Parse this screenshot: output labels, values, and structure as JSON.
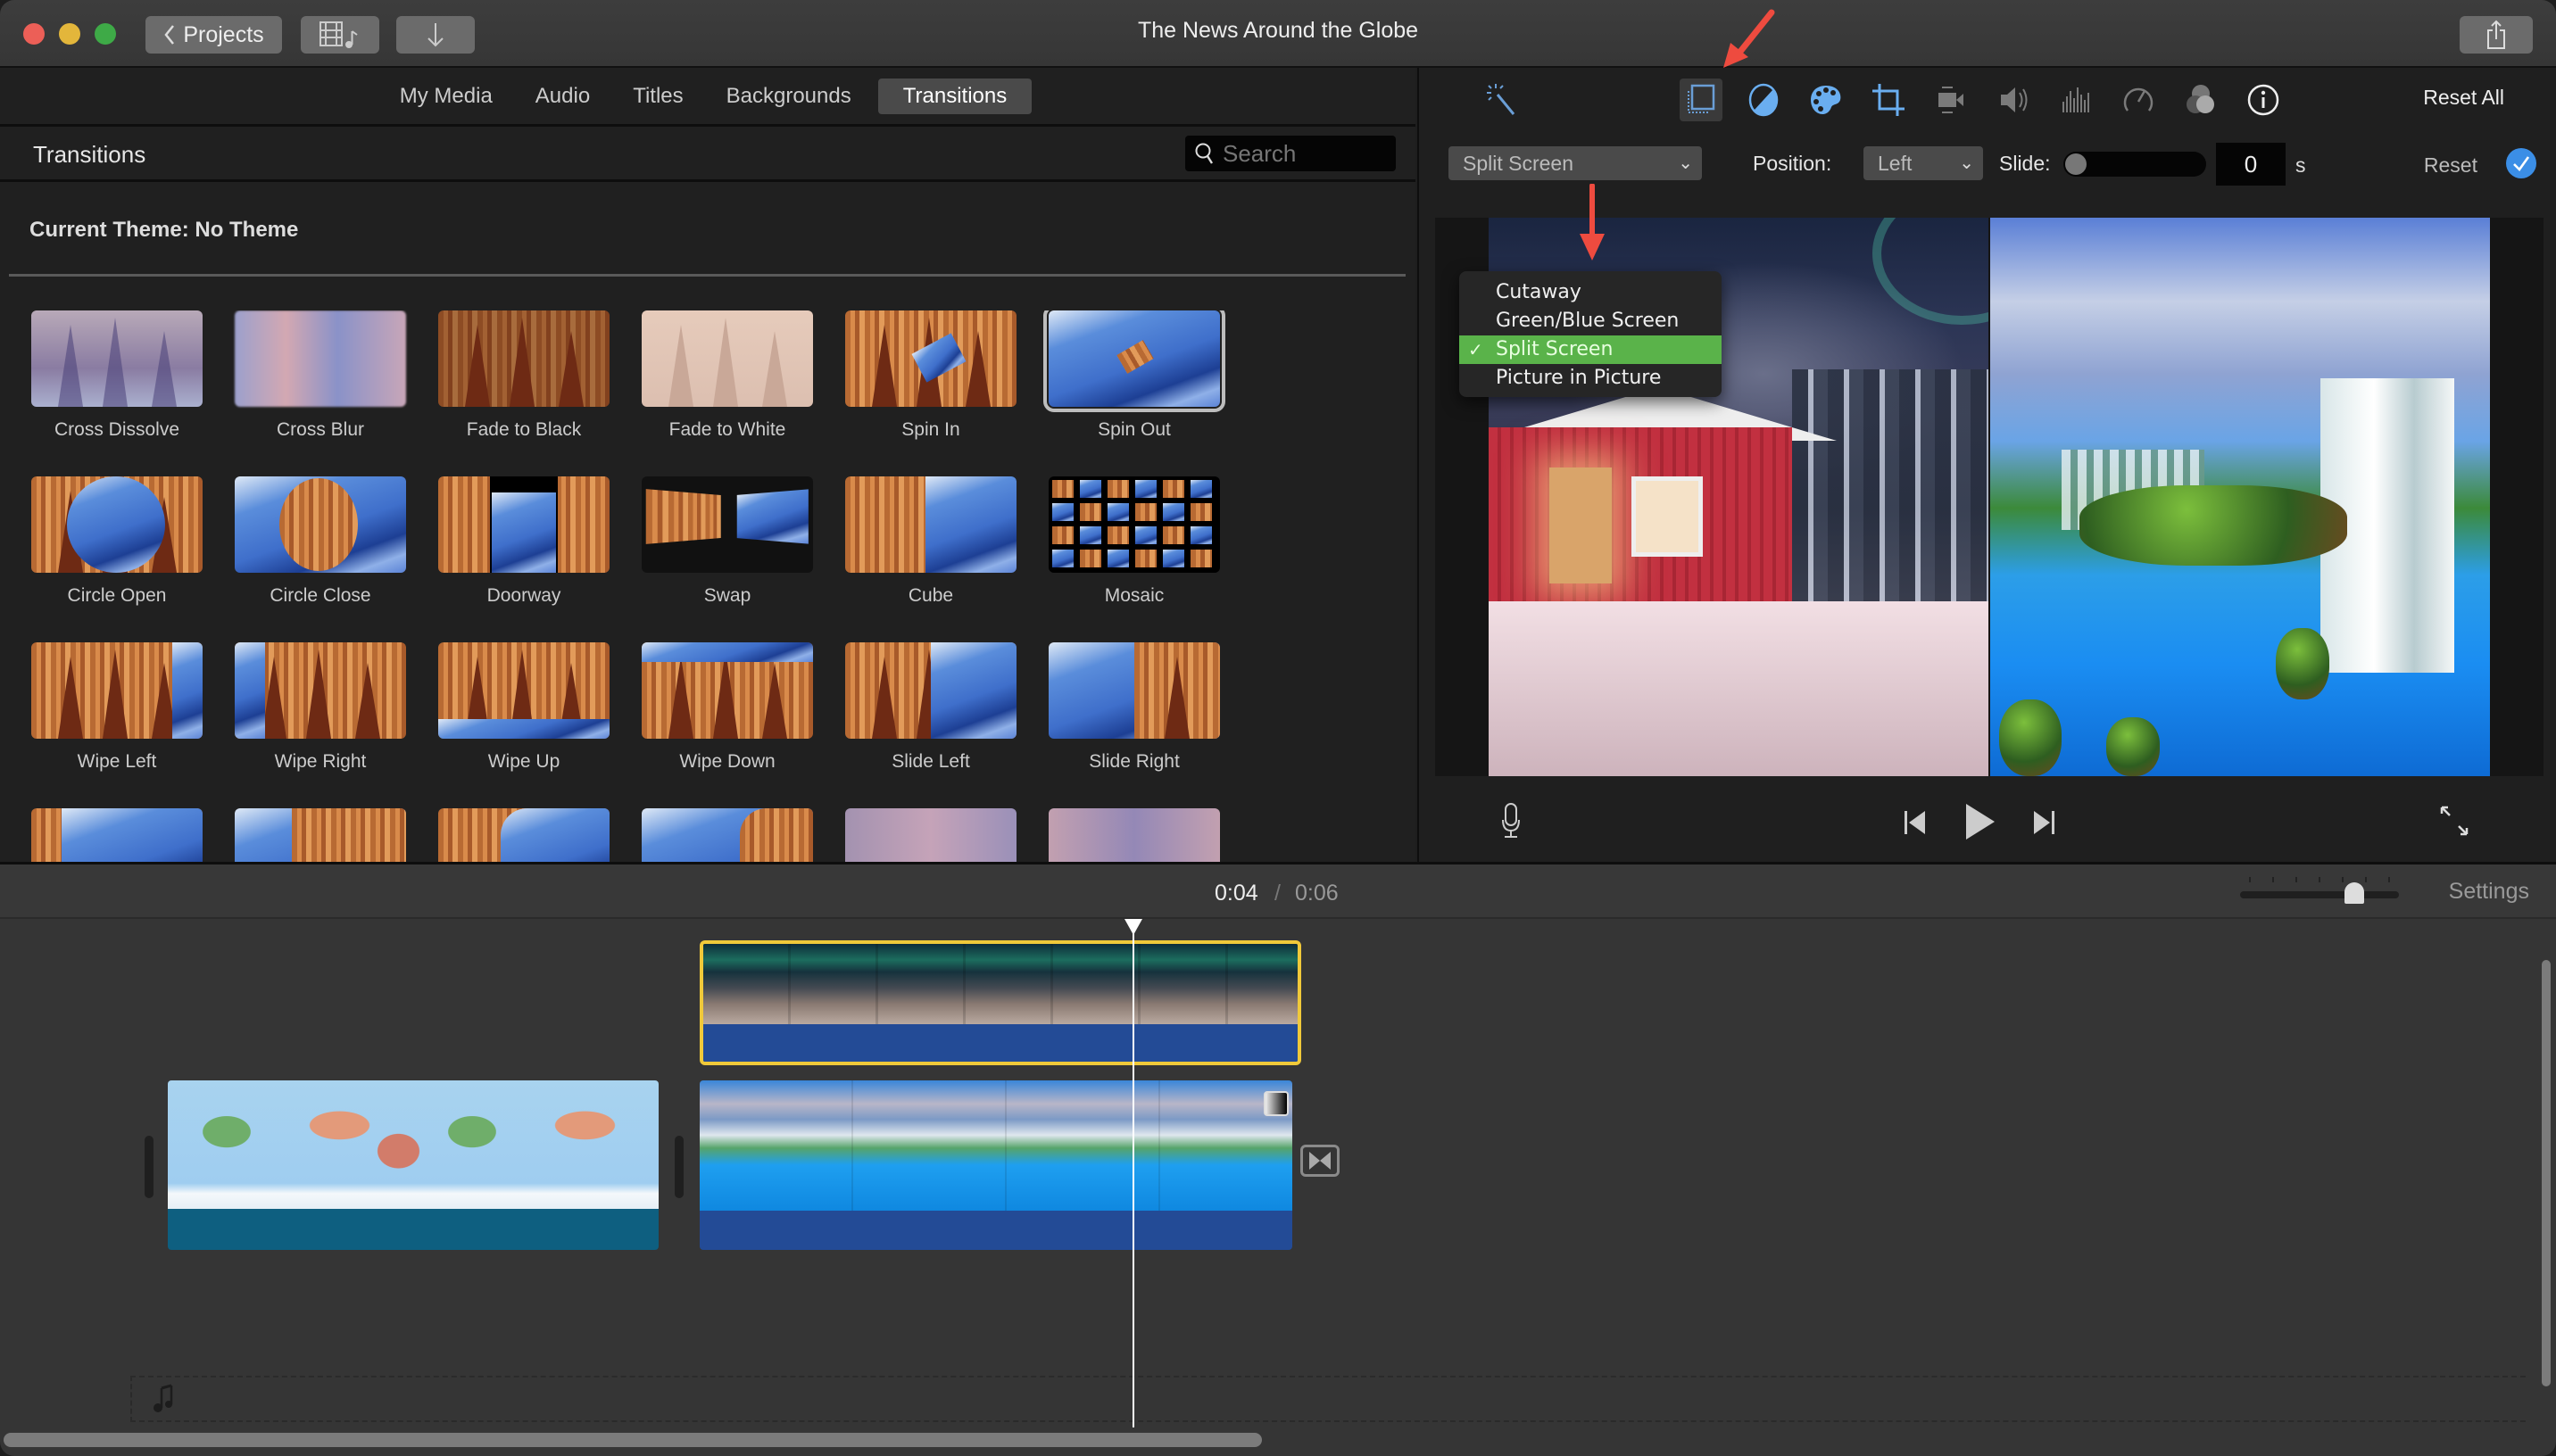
{
  "window": {
    "title": "The News Around the Globe",
    "projects_button": "Projects"
  },
  "browser": {
    "tabs": [
      {
        "label": "My Media",
        "active": false
      },
      {
        "label": "Audio",
        "active": false
      },
      {
        "label": "Titles",
        "active": false
      },
      {
        "label": "Backgrounds",
        "active": false
      },
      {
        "label": "Transitions",
        "active": true
      }
    ],
    "section_title": "Transitions",
    "search_placeholder": "Search",
    "current_theme": "Current Theme: No Theme",
    "transitions": [
      {
        "label": "Cross Dissolve"
      },
      {
        "label": "Cross Blur"
      },
      {
        "label": "Fade to Black"
      },
      {
        "label": "Fade to White"
      },
      {
        "label": "Spin In"
      },
      {
        "label": "Spin Out",
        "selected": true
      },
      {
        "label": "Circle Open"
      },
      {
        "label": "Circle Close"
      },
      {
        "label": "Doorway"
      },
      {
        "label": "Swap"
      },
      {
        "label": "Cube"
      },
      {
        "label": "Mosaic"
      },
      {
        "label": "Wipe Left"
      },
      {
        "label": "Wipe Right"
      },
      {
        "label": "Wipe Up"
      },
      {
        "label": "Wipe Down"
      },
      {
        "label": "Slide Left"
      },
      {
        "label": "Slide Right"
      }
    ]
  },
  "viewer": {
    "adjust_tools": [
      {
        "name": "enhance-wand-icon"
      },
      {
        "name": "video-overlay-icon",
        "active": true
      },
      {
        "name": "color-balance-icon"
      },
      {
        "name": "color-correction-icon"
      },
      {
        "name": "crop-icon"
      },
      {
        "name": "stabilization-icon"
      },
      {
        "name": "volume-icon"
      },
      {
        "name": "noise-reduction-icon"
      },
      {
        "name": "speed-icon"
      },
      {
        "name": "clip-filter-icon"
      },
      {
        "name": "clip-info-icon"
      }
    ],
    "reset_all": "Reset All",
    "overlay_mode": "Split Screen",
    "position_label": "Position:",
    "position_value": "Left",
    "slide_label": "Slide:",
    "slide_value": "0",
    "slide_unit": "s",
    "reset": "Reset",
    "overlay_menu": [
      {
        "label": "Cutaway",
        "checked": false
      },
      {
        "label": "Green/Blue Screen",
        "checked": false
      },
      {
        "label": "Split Screen",
        "checked": true
      },
      {
        "label": "Picture in Picture",
        "checked": false
      }
    ]
  },
  "timeline": {
    "current_time": "0:04",
    "separator": "/",
    "total_time": "0:06",
    "settings": "Settings",
    "zoom_level": 0.75
  },
  "colors": {
    "accent_blue": "#3b8ee6",
    "menu_check_green": "#5ab34a",
    "selected_clip_yellow": "#f0c93a",
    "annotation_red": "#ee4b3f"
  }
}
